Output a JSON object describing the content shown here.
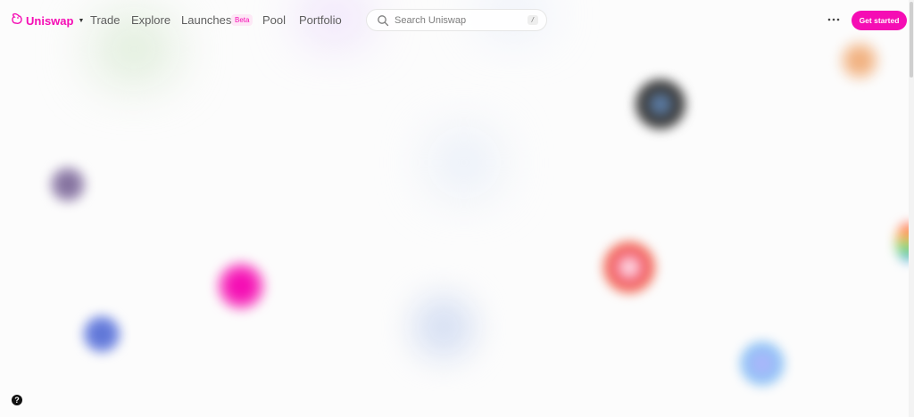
{
  "brand": {
    "name": "Uniswap",
    "accent_color": "#f50db4",
    "logo_icon": "unicorn-icon"
  },
  "nav": {
    "links": [
      {
        "label": "Trade"
      },
      {
        "label": "Explore"
      },
      {
        "label": "Launches",
        "badge": "Beta"
      },
      {
        "label": "Pool"
      },
      {
        "label": "Portfolio"
      }
    ]
  },
  "search": {
    "placeholder": "Search Uniswap",
    "shortcut": "/"
  },
  "actions": {
    "more_icon": "more-horizontal-icon",
    "get_started_label": "Get started"
  },
  "help": {
    "label": "?"
  },
  "background_tokens": [
    {
      "name": "token-purple-orb",
      "color": "#8c7aa8"
    },
    {
      "name": "token-blue-orb",
      "color": "#6f85e0"
    },
    {
      "name": "token-pink-unicorn",
      "color": "#f50db4"
    },
    {
      "name": "token-dark-stripes",
      "color": "#3a3a3a"
    },
    {
      "name": "token-orange-gradient",
      "color": "#f25a6b"
    },
    {
      "name": "token-cyan-violet",
      "color": "#8aa9f5"
    },
    {
      "name": "token-peach",
      "color": "#f1b07e"
    },
    {
      "name": "token-rainbow-edge",
      "color": "#ff5e5e"
    }
  ]
}
